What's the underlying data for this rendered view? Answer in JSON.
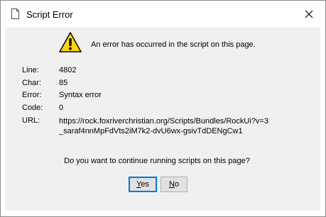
{
  "window": {
    "title": "Script Error",
    "title_icon": "document-icon",
    "close_icon": "close-icon"
  },
  "message": {
    "icon": "warning-icon",
    "text": "An error has occurred in the script on this page."
  },
  "details": {
    "line_label": "Line:",
    "line_value": "4802",
    "char_label": "Char:",
    "char_value": "85",
    "error_label": "Error:",
    "error_value": "Syntax error",
    "code_label": "Code:",
    "code_value": "0",
    "url_label": "URL:",
    "url_value": "https://rock.foxriverchristian.org/Scripts/Bundles/RockUi?v=3_saraf4nnMpFdVts2iM7k2-dvU6wx-gsivTdDENgCw1"
  },
  "prompt": {
    "question": "Do you want to continue running scripts on this page?"
  },
  "buttons": {
    "yes_label": "Yes",
    "no_label": "No"
  },
  "colors": {
    "content_bg": "#f0f0f0",
    "focus_border": "#0078d7",
    "warning_yellow": "#ffd700"
  }
}
